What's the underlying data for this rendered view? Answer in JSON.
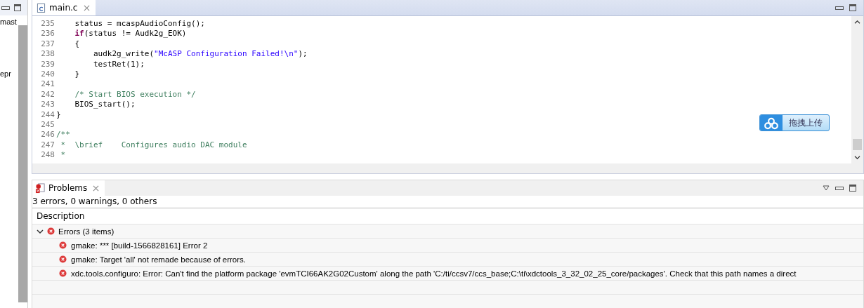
{
  "left_panel": {
    "items": [
      "mast",
      "epr"
    ]
  },
  "editor": {
    "tabs": [
      {
        "label": "main.c",
        "selected": true
      }
    ],
    "lines": [
      {
        "number": "235",
        "tokens": [
          {
            "kind": "plain",
            "text": "    status = mcaspAudioConfig();"
          }
        ]
      },
      {
        "number": "236",
        "tokens": [
          {
            "kind": "keyword",
            "text": "    if"
          },
          {
            "kind": "plain",
            "text": "(status != Audk2g_EOK)"
          }
        ]
      },
      {
        "number": "237",
        "tokens": [
          {
            "kind": "plain",
            "text": "    {"
          }
        ]
      },
      {
        "number": "238",
        "tokens": [
          {
            "kind": "plain",
            "text": "        audk2g_write("
          },
          {
            "kind": "string",
            "text": "\"McASP Configuration Failed!\\n\""
          },
          {
            "kind": "plain",
            "text": ");"
          }
        ]
      },
      {
        "number": "239",
        "tokens": [
          {
            "kind": "plain",
            "text": "        testRet(1);"
          }
        ]
      },
      {
        "number": "240",
        "tokens": [
          {
            "kind": "plain",
            "text": "    }"
          }
        ]
      },
      {
        "number": "241"
      },
      {
        "number": "242",
        "tokens": [
          {
            "kind": "comment",
            "text": "    /* Start BIOS execution */"
          }
        ]
      },
      {
        "number": "243",
        "tokens": [
          {
            "kind": "plain",
            "text": "    BIOS_start();"
          }
        ]
      },
      {
        "number": "244",
        "tokens": [
          {
            "kind": "plain",
            "text": "}"
          }
        ]
      },
      {
        "number": "245"
      },
      {
        "number": "246",
        "tokens": [
          {
            "kind": "comment",
            "text": "/**"
          }
        ]
      },
      {
        "number": "247",
        "tokens": [
          {
            "kind": "comment",
            "text": " *  \\brief    Configures audio DAC module"
          }
        ]
      },
      {
        "number": "248",
        "tokens": [
          {
            "kind": "comment",
            "text": " *"
          }
        ]
      }
    ],
    "upload_button": {
      "label": "拖拽上传"
    }
  },
  "problems": {
    "tab": {
      "label": "Problems",
      "selected": true
    },
    "summary": "3 errors, 0 warnings, 0 others",
    "columns": [
      "Description"
    ],
    "groups": [
      {
        "label": "Errors (3 items)",
        "expanded": true,
        "children": [
          {
            "text": "gmake: *** [build-1566828161] Error 2"
          },
          {
            "text": "gmake: Target 'all' not remade because of errors."
          },
          {
            "text": "xdc.tools.configuro: Error: Can't find the platform package 'evmTCI66AK2G02Custom' along the path 'C:/ti/ccsv7/ccs_base;C:\\ti\\xdctools_3_32_02_25_core/packages'.  Check that this path names a direct"
          }
        ]
      }
    ]
  }
}
